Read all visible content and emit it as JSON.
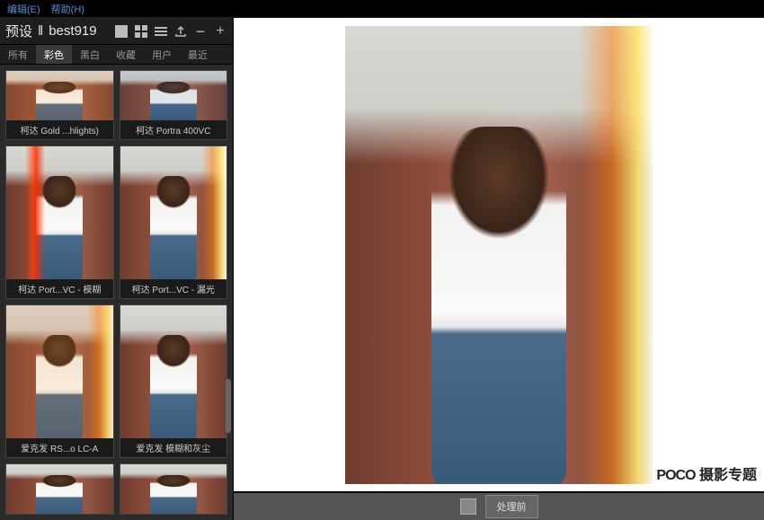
{
  "menu": {
    "edit": "编辑(E)",
    "help": "帮助(H)"
  },
  "sidebar": {
    "title_prefix": "预设",
    "title_sep": "‖",
    "title_name": "best919",
    "tabs": [
      "所有",
      "彩色",
      "黑白",
      "收藏",
      "用户",
      "最近"
    ],
    "active_tab": 1
  },
  "presets": [
    {
      "label": "柯达 Gold ...hlights)",
      "variant": "warm",
      "tall": false
    },
    {
      "label": "柯达 Portra 400VC",
      "variant": "cool",
      "tall": false
    },
    {
      "label": "柯达 Port...VC - 模糊",
      "variant": "flare-l",
      "tall": true
    },
    {
      "label": "柯达 Port...VC - 漏光",
      "variant": "flare-r",
      "tall": true
    },
    {
      "label": "爱克发 RS...o LC-A",
      "variant": "flare-r-warm",
      "tall": true
    },
    {
      "label": "爱克发 模糊和灰尘",
      "variant": "plain",
      "tall": true
    },
    {
      "label": "",
      "variant": "plain",
      "tall": false
    },
    {
      "label": "",
      "variant": "plain",
      "tall": false
    }
  ],
  "bottom": {
    "before_btn": "处理前"
  },
  "watermark": {
    "brand": "POCO",
    "suffix": " 摄影专题"
  }
}
